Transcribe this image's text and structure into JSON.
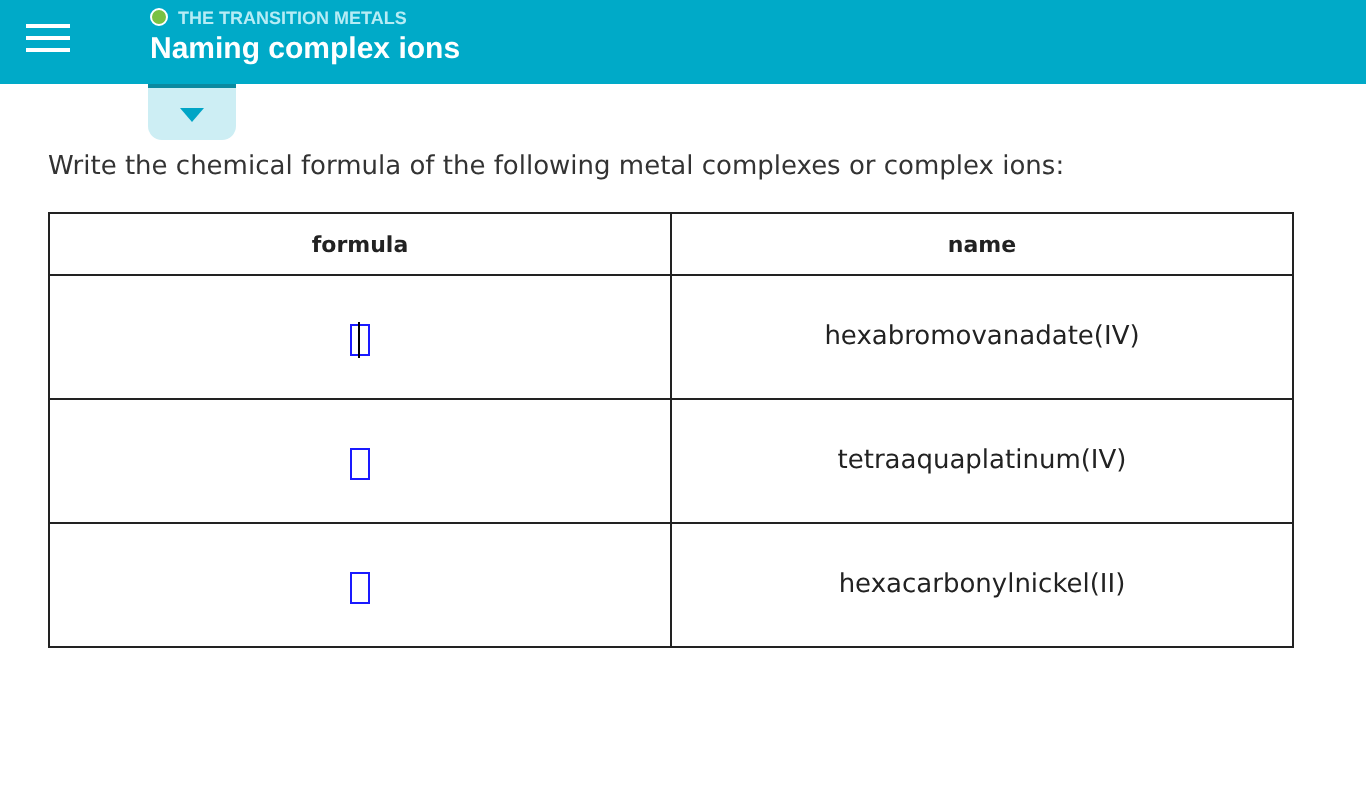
{
  "header": {
    "topic": "THE TRANSITION METALS",
    "title": "Naming complex ions"
  },
  "question": "Write the chemical formula of the following metal complexes or complex ions:",
  "table": {
    "columns": [
      "formula",
      "name"
    ],
    "rows": [
      {
        "name": "hexabromovanadate(IV)",
        "focused": true
      },
      {
        "name": "tetraaquaplatinum(IV)",
        "focused": false
      },
      {
        "name": "hexacarbonylnickel(II)",
        "focused": false
      }
    ]
  }
}
